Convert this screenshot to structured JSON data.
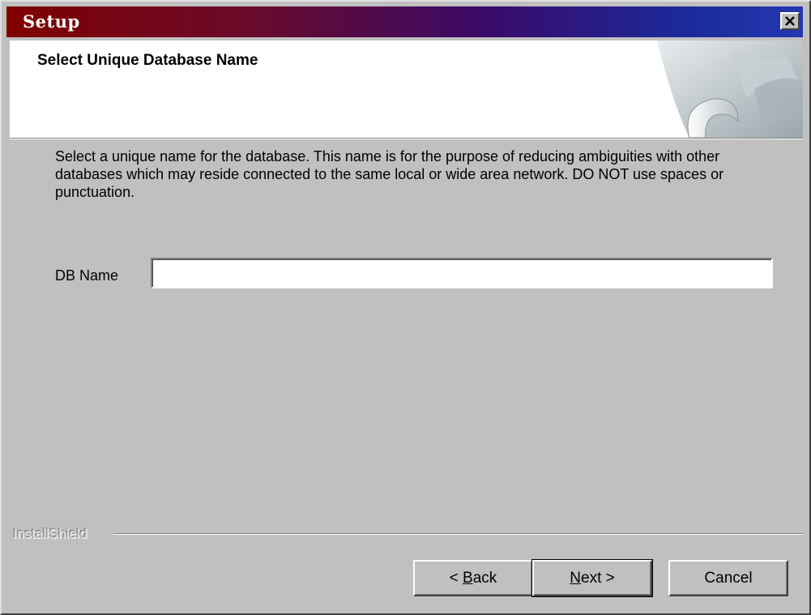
{
  "window": {
    "title": "Setup",
    "close_icon": "close-icon"
  },
  "header": {
    "title": "Select Unique Database Name",
    "graphic": "installshield-page-curl-graphic"
  },
  "main": {
    "description": "Select a unique name for the database.  This name is for the purpose of reducing ambiguities with other databases which may reside connected to the same local or wide area network.  DO NOT use spaces or punctuation.",
    "db_name_label": "DB Name",
    "db_name_value": ""
  },
  "footer": {
    "brand": "InstallShield",
    "buttons": {
      "back": {
        "prefix": "< ",
        "mnemonic": "B",
        "rest": "ack"
      },
      "next": {
        "mnemonic": "N",
        "rest": "ext >"
      },
      "cancel": "Cancel"
    }
  },
  "colors": {
    "title_gradient_start": "#7f0000",
    "title_gradient_end": "#2438b0",
    "dialog_face": "#c0c0c0"
  }
}
